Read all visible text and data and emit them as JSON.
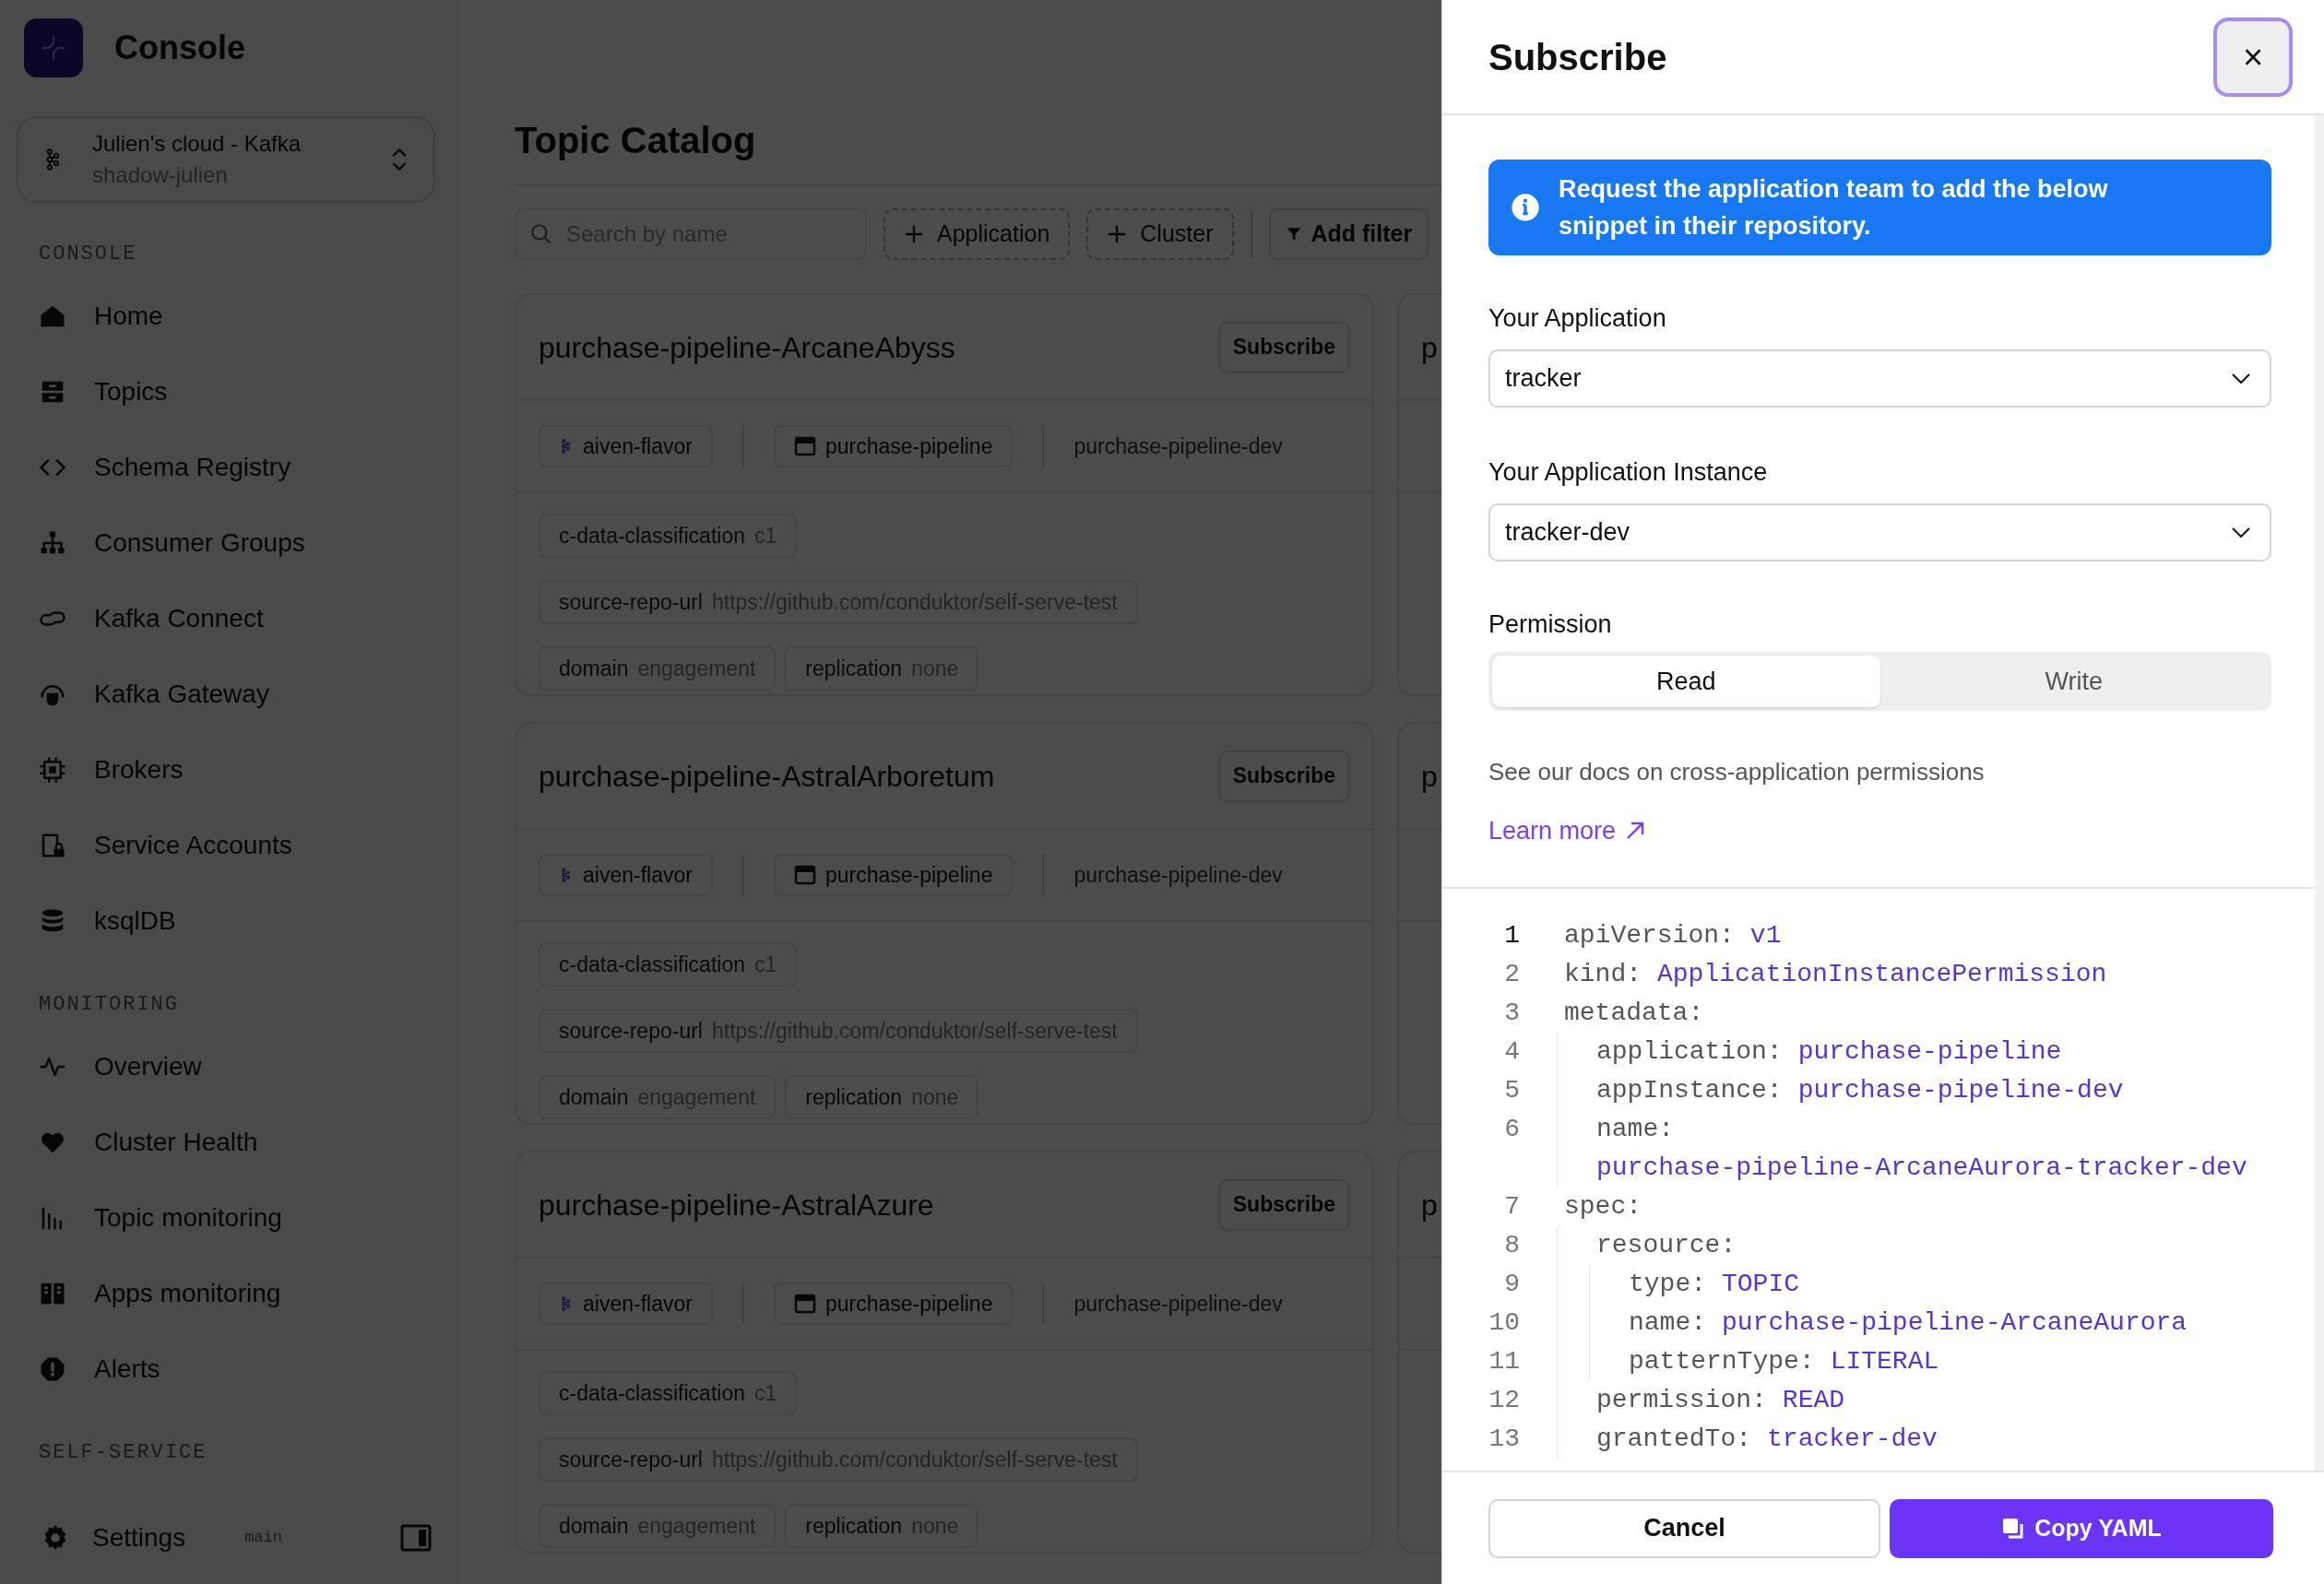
{
  "app": {
    "title": "Console"
  },
  "cluster_selector": {
    "name": "Julien's cloud - Kafka",
    "subtitle": "shadow-julien"
  },
  "sidebar": {
    "sections": [
      {
        "heading": "CONSOLE",
        "items": [
          "Home",
          "Topics",
          "Schema Registry",
          "Consumer Groups",
          "Kafka Connect",
          "Kafka Gateway",
          "Brokers",
          "Service Accounts",
          "ksqlDB"
        ]
      },
      {
        "heading": "MONITORING",
        "items": [
          "Overview",
          "Cluster Health",
          "Topic monitoring",
          "Apps monitoring",
          "Alerts"
        ]
      },
      {
        "heading": "SELF-SERVICE"
      }
    ],
    "footer": {
      "settings": "Settings",
      "branch": "main"
    }
  },
  "page": {
    "title": "Topic Catalog",
    "search": {
      "placeholder": "Search by name"
    },
    "filters": [
      "Application",
      "Cluster"
    ],
    "add_filter": "Add filter"
  },
  "card_rows": [
    {
      "card": {
        "title": "purchase-pipeline-ArcaneAbyss",
        "action": "Subscribe",
        "cluster": "aiven-flavor",
        "application": "purchase-pipeline",
        "instance": "purchase-pipeline-dev",
        "labels": [
          {
            "key": "c-data-classification",
            "value": "c1"
          },
          {
            "key": "source-repo-url",
            "value": "https://github.com/conduktor/self-serve-test"
          },
          {
            "key": "domain",
            "value": "engagement"
          },
          {
            "key": "replication",
            "value": "none"
          }
        ]
      },
      "next_card": {
        "title": "p"
      }
    },
    {
      "card": {
        "title": "purchase-pipeline-AstralArboretum",
        "action": "Subscribe",
        "cluster": "aiven-flavor",
        "application": "purchase-pipeline",
        "instance": "purchase-pipeline-dev",
        "labels": [
          {
            "key": "c-data-classification",
            "value": "c1"
          },
          {
            "key": "source-repo-url",
            "value": "https://github.com/conduktor/self-serve-test"
          },
          {
            "key": "domain",
            "value": "engagement"
          },
          {
            "key": "replication",
            "value": "none"
          }
        ]
      },
      "next_card": {
        "title": "p"
      }
    },
    {
      "card": {
        "title": "purchase-pipeline-AstralAzure",
        "action": "Subscribe",
        "cluster": "aiven-flavor",
        "application": "purchase-pipeline",
        "instance": "purchase-pipeline-dev",
        "labels": [
          {
            "key": "c-data-classification",
            "value": "c1"
          },
          {
            "key": "source-repo-url",
            "value": "https://github.com/conduktor/self-serve-test"
          },
          {
            "key": "domain",
            "value": "engagement"
          },
          {
            "key": "replication",
            "value": "none"
          }
        ]
      },
      "next_card": {
        "title": "p"
      }
    }
  ],
  "drawer": {
    "title": "Subscribe",
    "close": "×",
    "info": "Request the application team to add the below snippet in their repository.",
    "fields": [
      {
        "label": "Your Application",
        "value": "tracker"
      },
      {
        "label": "Your Application Instance",
        "value": "tracker-dev"
      }
    ],
    "permission": {
      "label": "Permission",
      "options": [
        {
          "label": "Read",
          "selected": true
        },
        {
          "label": "Write",
          "selected": false
        }
      ]
    },
    "docs_text": "See our docs on cross-application permissions",
    "docs_link": "Learn more",
    "code": [
      {
        "num": "1",
        "key": "apiVersion:",
        "value": "v1",
        "current": true
      },
      {
        "num": "2",
        "key": "kind:",
        "value": "ApplicationInstancePermission",
        "current": false
      },
      {
        "num": "3",
        "key": "metadata:",
        "current": false,
        "children": [
          {
            "num": "4",
            "key": "application:",
            "value": "purchase-pipeline",
            "current": false
          },
          {
            "num": "5",
            "key": "appInstance:",
            "value": "purchase-pipeline-dev",
            "current": false
          },
          {
            "num": "6",
            "key": "name:",
            "value": "purchase-pipeline-ArcaneAurora-tracker-dev",
            "current": false
          }
        ]
      },
      {
        "num": "7",
        "key": "spec:",
        "current": false,
        "children": [
          {
            "num": "8",
            "key": "resource:",
            "current": false,
            "children": [
              {
                "num": "9",
                "key": "type:",
                "value": "TOPIC",
                "current": false
              },
              {
                "num": "10",
                "key": "name:",
                "value": "purchase-pipeline-ArcaneAurora",
                "current": false
              },
              {
                "num": "11",
                "key": "patternType:",
                "value": "LITERAL",
                "current": false
              }
            ]
          },
          {
            "num": "12",
            "key": "permission:",
            "value": "READ",
            "current": false
          },
          {
            "num": "13",
            "key": "grantedTo:",
            "value": "tracker-dev",
            "current": false
          }
        ]
      }
    ],
    "buttons": {
      "cancel": "Cancel",
      "copy": "Copy YAML"
    }
  }
}
